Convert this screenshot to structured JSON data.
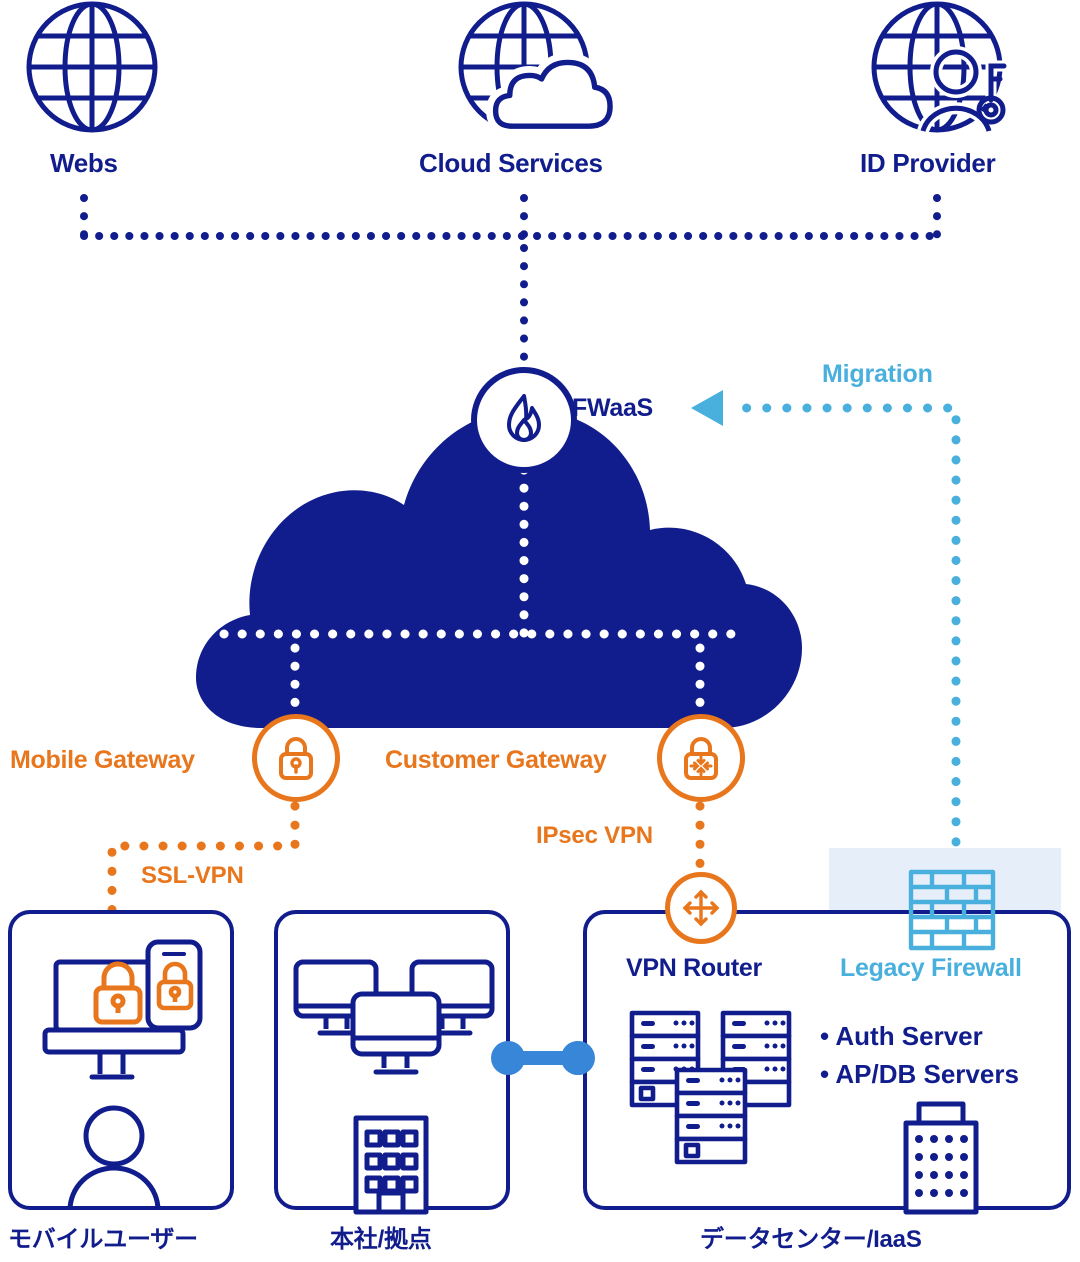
{
  "diagram": {
    "title": "Zero Trust / SASE network migration architecture",
    "colors": {
      "navy": "#111d8c",
      "orange": "#e8761c",
      "light_blue": "#49b0de",
      "mid_blue": "#3886d8",
      "panel_bg": "#e5eef9",
      "white": "#ffffff"
    }
  },
  "top_nodes": [
    {
      "id": "webs",
      "label": "Webs",
      "icon": "globe-icon"
    },
    {
      "id": "cloud-services",
      "label": "Cloud Services",
      "icon": "globe-cloud-icon"
    },
    {
      "id": "id-provider",
      "label": "ID Provider",
      "icon": "globe-user-key-icon"
    }
  ],
  "cloud_nodes": {
    "fwaas": {
      "label": "FWaaS",
      "icon": "flame-icon"
    },
    "mobile_gateway": {
      "label": "Mobile Gateway",
      "icon": "padlock-icon"
    },
    "customer_gateway": {
      "label": "Customer Gateway",
      "icon": "padlock-arrows-icon"
    }
  },
  "annotations": {
    "migration": {
      "label": "Migration",
      "color": "#49b0de"
    },
    "ssl_vpn": {
      "label": "SSL-VPN",
      "color": "#e8761c"
    },
    "ipsec_vpn": {
      "label": "IPsec VPN",
      "color": "#e8761c"
    }
  },
  "site_boxes": [
    {
      "id": "mobile-user",
      "caption": "モバイルユーザー",
      "icons": [
        "monitor-lock-icon",
        "smartphone-lock-icon",
        "person-icon"
      ]
    },
    {
      "id": "headquarters",
      "caption": "本社/拠点",
      "icons": [
        "desktop-monitors-icon",
        "office-building-icon"
      ]
    },
    {
      "id": "data-center",
      "caption": "データセンター/IaaS",
      "icons": [
        "server-racks-icon",
        "office-building-icon"
      ],
      "nodes": {
        "vpn_router": {
          "label": "VPN Router",
          "icon": "four-way-arrow-icon"
        },
        "legacy_firewall": {
          "label": "Legacy Firewall",
          "icon": "brick-wall-icon"
        }
      },
      "server_list": [
        "Auth Server",
        "AP/DB Servers"
      ],
      "bullet_char": "•"
    }
  ],
  "connections": [
    {
      "from": "webs",
      "to": "internet-bus",
      "style": "dotted",
      "color": "#111d8c"
    },
    {
      "from": "cloud-services",
      "to": "fwaas",
      "style": "dotted",
      "color": "#111d8c"
    },
    {
      "from": "id-provider",
      "to": "internet-bus",
      "style": "dotted",
      "color": "#111d8c"
    },
    {
      "from": "fwaas",
      "to": "cloud-bus",
      "style": "dotted",
      "color": "#ffffff"
    },
    {
      "from": "cloud-bus",
      "to": "mobile-gateway",
      "style": "dotted",
      "color": "#ffffff"
    },
    {
      "from": "cloud-bus",
      "to": "customer-gateway",
      "style": "dotted",
      "color": "#ffffff"
    },
    {
      "from": "mobile-gateway",
      "to": "mobile-user",
      "style": "dotted",
      "color": "#e8761c",
      "label": "SSL-VPN"
    },
    {
      "from": "customer-gateway",
      "to": "vpn-router",
      "style": "dotted",
      "color": "#e8761c",
      "label": "IPsec VPN"
    },
    {
      "from": "legacy-firewall",
      "to": "fwaas",
      "style": "dotted",
      "color": "#49b0de",
      "label": "Migration",
      "arrow": "left"
    },
    {
      "from": "headquarters",
      "to": "data-center",
      "style": "solid-dumbbell",
      "color": "#3886d8"
    }
  ]
}
